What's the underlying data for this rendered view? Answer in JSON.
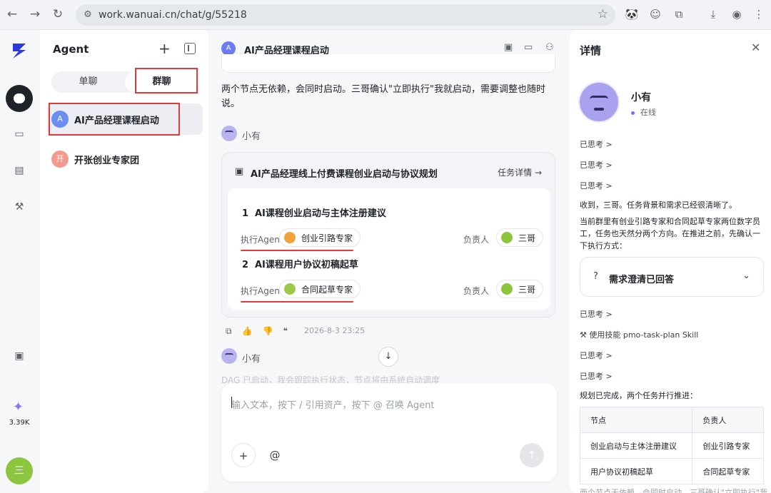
{
  "browser": {
    "back": "←",
    "forward": "→",
    "reload": "↻",
    "url": "work.wanuai.cn/chat/g/55218",
    "star": "☆",
    "more": "⋮"
  },
  "rail": {
    "credit_count": "3.39K",
    "user_initial": "三"
  },
  "sidebar": {
    "title": "Agent",
    "tabs": [
      {
        "label": "单聊"
      },
      {
        "label": "群聊"
      }
    ],
    "conversations": [
      {
        "avatar": "A",
        "label": "AI产品经理课程启动",
        "color": "#6a8ef0"
      },
      {
        "avatar": "开",
        "label": "开张创业专家团",
        "color": "#f08f8f"
      }
    ]
  },
  "chat": {
    "title_avatar": "A",
    "title": "AI产品经理课程启动",
    "message1": "两个节点无依赖，会同时启动。三哥确认\"立即执行\"我就启动，需要调整也随时说。",
    "bot_name": "小有",
    "task_card": {
      "title": "AI产品经理线上付费课程创业启动与协议规划",
      "detail_link": "任务详情 →",
      "tasks": [
        {
          "num": "1",
          "title": "AI课程创业启动与主体注册建议",
          "exec_label": "执行Agent",
          "agent": "创业引路专家",
          "owner_label": "负责人",
          "owner": "三哥"
        },
        {
          "num": "2",
          "title": "AI课程用户协议初稿起草",
          "exec_label": "执行Agent",
          "agent": "合同起草专家",
          "owner_label": "负责人",
          "owner": "三哥"
        }
      ]
    },
    "timestamp": "2026-8-3 23:25",
    "bot_name2": "小有",
    "faded_text": "DAG 已启动，我会跟踪执行状态，节点将由系统自动调度",
    "input_placeholder": "输入文本，按下 / 引用资产，按下 @ 召唤 Agent",
    "at_symbol": "@",
    "plus_symbol": "+"
  },
  "details": {
    "title": "详情",
    "agent_name": "小有",
    "status": "在线",
    "thought_label": "已思考 >",
    "reply1": "收到，三哥。任务背景和需求已经很清晰了。",
    "reply2": "当前群里有创业引路专家和合同起草专家两位数字员工，任务也天然分两个方向。在推进之前，先确认一下执行方式：",
    "clarify": "需求澄清已回答",
    "skill": "使用技能 pmo-task-plan Skill",
    "plan_done": "规划已完成，两个任务并行推进：",
    "table": {
      "headers": [
        "节点",
        "负责人"
      ],
      "rows": [
        [
          "创业启动与主体注册建议",
          "创业引路专家"
        ],
        [
          "用户协议初稿起草",
          "合同起草专家"
        ]
      ]
    },
    "bottom_text": "两个节点无依赖，会同时启动。三哥确认\"立即执行\"我"
  }
}
